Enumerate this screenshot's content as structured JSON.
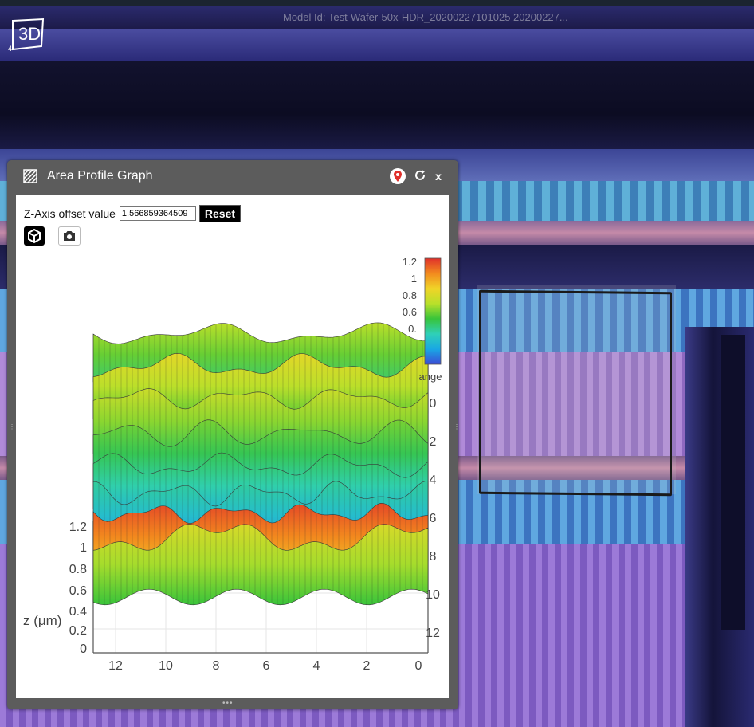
{
  "app": {
    "model_id": "Model Id: Test-Wafer-50x-HDR_20200227101025 20200227...",
    "logo_text": "3D",
    "logo_edge_text": "4"
  },
  "panel": {
    "title": "Area Profile Graph",
    "icon": "hatch-icon",
    "pin_icon": "map-pin-icon",
    "refresh_icon": "refresh-icon",
    "close_label": "x",
    "offset_label": "Z-Axis offset value",
    "offset_value": "1.566859364509",
    "reset_label": "Reset",
    "tool_3d_icon": "cube-icon",
    "tool_camera_icon": "camera-icon"
  },
  "chart_data": {
    "type": "surface",
    "zlabel": "z (μm)",
    "colorbar_label": "ange",
    "colorbar_ticks": [
      "1.2",
      "1",
      "0.8",
      "0.6",
      "0."
    ],
    "z_ticks": [
      "0",
      "0.2",
      "0.4",
      "0.6",
      "0.8",
      "1",
      "1.2"
    ],
    "x_ticks": [
      "12",
      "10",
      "8",
      "6",
      "4",
      "2",
      "0"
    ],
    "y_ticks": [
      "0",
      "2",
      "4",
      "6",
      "8",
      "10",
      "12"
    ],
    "colorscale": [
      "#3b4bd6",
      "#19a7e4",
      "#2fd0b8",
      "#38c43a",
      "#b8e02a",
      "#f0d428",
      "#f28a1e",
      "#e0302b"
    ],
    "zlim": [
      0,
      1.2
    ]
  }
}
